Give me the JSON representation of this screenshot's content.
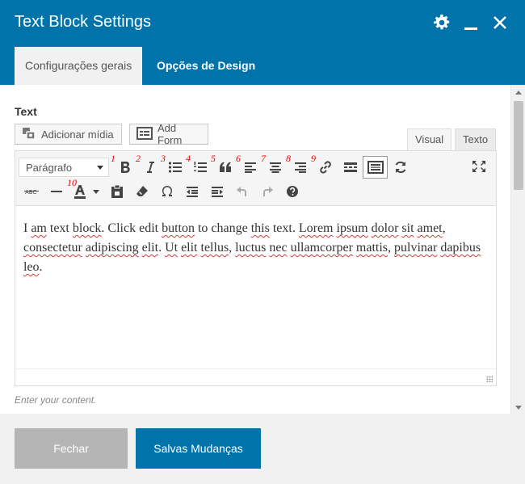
{
  "window": {
    "title": "Text Block Settings",
    "icons": [
      "gear-icon",
      "minimize-icon",
      "close-icon"
    ]
  },
  "tabs": [
    {
      "label": "Configurações gerais",
      "active": true
    },
    {
      "label": "Opções de Design",
      "active": false
    }
  ],
  "field": {
    "label": "Text",
    "add_media_label": "Adicionar mídia",
    "add_form_label": "Add Form",
    "hint": "Enter your content."
  },
  "editor": {
    "visual_tab": "Visual",
    "text_tab": "Texto",
    "format_select": "Parágrafo",
    "row1_annotations": [
      "1",
      "2",
      "3",
      "4",
      "5",
      "6",
      "7",
      "8",
      "9"
    ],
    "row2_annotations": [
      "10"
    ],
    "content": {
      "t1": "I ",
      "s1": "am",
      "t2": " text ",
      "s2": "block",
      "t3": ". Click edit ",
      "s3": "button",
      "t4": " to change ",
      "s4": "this",
      "t5": " text. ",
      "s5": "Lorem",
      "t6": " ",
      "s6": "ipsum",
      "t7": " ",
      "s7": "dolor",
      "t8": " ",
      "s8": "sit",
      "t9": " ",
      "s9": "amet",
      "t10": ", ",
      "s10": "consectetur",
      "t11": " ",
      "s11": "adipiscing",
      "t12": " ",
      "s12": "elit",
      "t13": ". ",
      "s13": "Ut",
      "t14": " ",
      "s14": "elit",
      "t15": " ",
      "s15": "tellus",
      "t16": ", ",
      "s16": "luctus",
      "t17": " ",
      "s17": "nec",
      "t18": " ",
      "s18": "ullamcorper",
      "t19": " ",
      "s19": "mattis",
      "t20": ", ",
      "s20": "pulvinar",
      "t21": " ",
      "s21": "dapibus",
      "t22": " ",
      "s22": "leo",
      "t23": "."
    }
  },
  "footer": {
    "close_label": "Fechar",
    "save_label": "Salvas Mudanças"
  },
  "colors": {
    "primary": "#0073aa",
    "disabled": "#b5b5b5",
    "annotation": "#e00000"
  }
}
